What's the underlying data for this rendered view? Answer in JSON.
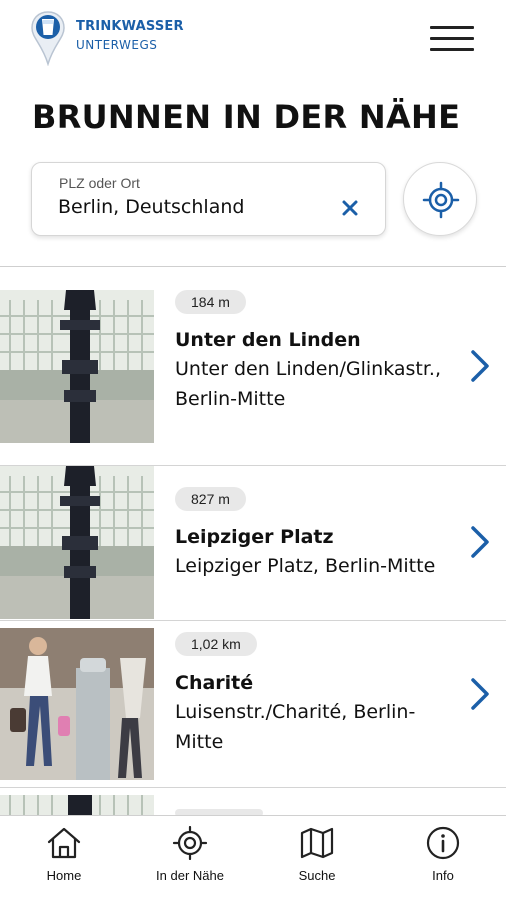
{
  "app": {
    "logo_line1": "TRINKWASSER",
    "logo_line2": "UNTERWEGS",
    "brand_color": "#1b5fa8"
  },
  "header": {
    "menu_icon": "hamburger-menu-icon"
  },
  "page": {
    "title": "BRUNNEN IN DER NÄHE"
  },
  "search": {
    "label": "PLZ oder Ort",
    "value": "Berlin, Deutschland",
    "clear_icon": "close-icon",
    "locate_icon": "crosshair-location-icon"
  },
  "results": [
    {
      "distance": "184 m",
      "name": "Unter den Linden",
      "address": "Unter den Linden/Glinkastr., Berlin-Mitte"
    },
    {
      "distance": "827 m",
      "name": "Leipziger Platz",
      "address": "Leipziger Platz, Berlin-Mitte"
    },
    {
      "distance": "1,02 km",
      "name": "Charité",
      "address": "Luisenstr./Charité, Berlin-Mitte"
    }
  ],
  "nav": {
    "home": "Home",
    "nearby": "In der Nähe",
    "search": "Suche",
    "info": "Info"
  },
  "colors": {
    "accent": "#1b5fa8",
    "text": "#111111",
    "badge_bg": "#e8e8e8"
  }
}
